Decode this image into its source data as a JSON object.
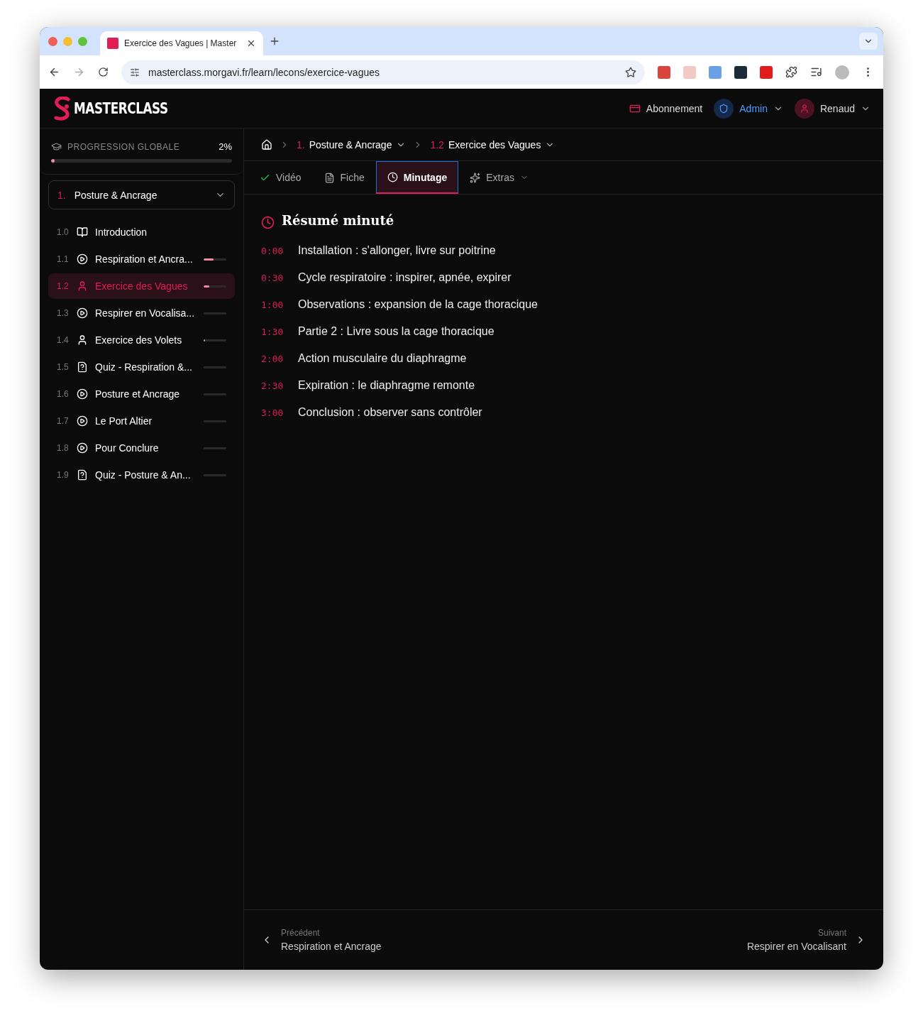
{
  "browser": {
    "tab_title": "Exercice des Vagues | Master",
    "url": "masterclass.morgavi.fr/learn/lecons/exercice-vagues"
  },
  "header": {
    "logo": "MASTERCLASS",
    "links": [
      {
        "kind": "subscription",
        "label": "Abonnement"
      },
      {
        "kind": "admin",
        "label": "Admin"
      },
      {
        "kind": "user",
        "label": "Renaud"
      }
    ]
  },
  "sidebar": {
    "progress": {
      "label": "PROGRESSION GLOBALE",
      "value": "2%",
      "level": 0.02
    },
    "module": {
      "number": "1.",
      "title": "Posture & Ancrage",
      "expanded": true
    },
    "lessons": [
      {
        "number": "1.0",
        "kind": "book",
        "title": "Introduction",
        "selected": false
      },
      {
        "number": "1.1",
        "kind": "video",
        "title": "Respiration et Ancra...",
        "selected": false,
        "level": 0.45
      },
      {
        "number": "1.2",
        "kind": "audio",
        "title": "Exercice des Vagues",
        "selected": true,
        "level": 0.25
      },
      {
        "number": "1.3",
        "kind": "video",
        "title": "Respirer en Vocalisa...",
        "selected": false,
        "level": 0
      },
      {
        "number": "1.4",
        "kind": "audio",
        "title": "Exercice des Volets",
        "selected": false,
        "level": 0.02
      },
      {
        "number": "1.5",
        "kind": "quiz",
        "title": "Quiz - Respiration &...",
        "selected": false,
        "level": 0
      },
      {
        "number": "1.6",
        "kind": "video",
        "title": "Posture et Ancrage",
        "selected": false,
        "level": 0
      },
      {
        "number": "1.7",
        "kind": "video",
        "title": "Le Port Altier",
        "selected": false,
        "level": 0
      },
      {
        "number": "1.8",
        "kind": "video",
        "title": "Pour Conclure",
        "selected": false,
        "level": 0
      },
      {
        "number": "1.9",
        "kind": "quiz",
        "title": "Quiz - Posture & An...",
        "selected": false,
        "level": 0
      }
    ]
  },
  "breadcrumb": [
    {
      "number": "1.",
      "title": "Posture & Ancrage"
    },
    {
      "number": "1.2",
      "title": "Exercice des Vagues"
    }
  ],
  "tabs": [
    {
      "kind": "check",
      "label": "Vidéo",
      "selected": false
    },
    {
      "kind": "doc",
      "label": "Fiche",
      "selected": false
    },
    {
      "kind": "clock",
      "label": "Minutage",
      "selected": true
    },
    {
      "kind": "sparkles",
      "label": "Extras",
      "selected": false,
      "dropdown": true
    }
  ],
  "summary": {
    "title": "Résumé minuté",
    "entries": [
      {
        "time": "0:00",
        "text": "Installation : s'allonger, livre sur poitrine"
      },
      {
        "time": "0:30",
        "text": "Cycle respiratoire : inspirer, apnée, expirer"
      },
      {
        "time": "1:00",
        "text": "Observations : expansion de la cage thoracique"
      },
      {
        "time": "1:30",
        "text": "Partie 2 : Livre sous la cage thoracique"
      },
      {
        "time": "2:00",
        "text": "Action musculaire du diaphragme"
      },
      {
        "time": "2:30",
        "text": "Expiration : le diaphragme remonte"
      },
      {
        "time": "3:00",
        "text": "Conclusion : observer sans contrôler"
      }
    ]
  },
  "pager": {
    "previous": {
      "label": "Précédent",
      "title": "Respiration et Ancrage"
    },
    "next": {
      "label": "Suivant",
      "title": "Respirer en Vocalisant"
    }
  }
}
